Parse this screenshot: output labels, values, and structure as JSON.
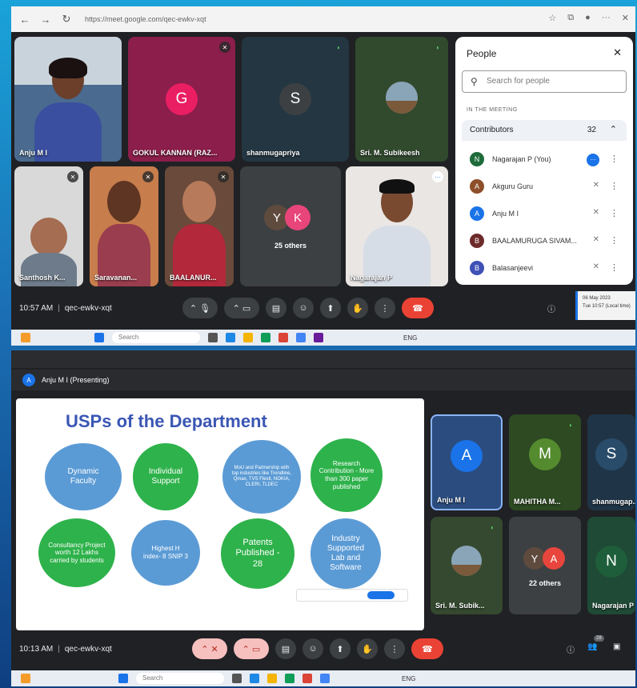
{
  "screen1": {
    "browser": {
      "url": "https://meet.google.com/qec-ewkv-xqt"
    },
    "tiles": [
      {
        "name": "Anju M I"
      },
      {
        "name": "GOKUL KANNAN (RAZ...",
        "initial": "G",
        "color": "#e91e63"
      },
      {
        "name": "shanmugapriya",
        "initial": "S",
        "color": "#3c4043"
      },
      {
        "name": "Sri. M. Subikeesh"
      },
      {
        "name": "Santhosh K..."
      },
      {
        "name": "Saravanan..."
      },
      {
        "name": "BAALANUR..."
      },
      {
        "others_label": "25 others",
        "initials": [
          "Y",
          "K"
        ]
      },
      {
        "name": "Nagarajan P"
      }
    ],
    "people_panel": {
      "title": "People",
      "search_placeholder": "Search for people",
      "section": "IN THE MEETING",
      "contributors_label": "Contributors",
      "contributors_count": "32",
      "people": [
        {
          "initial": "N",
          "name": "Nagarajan P (You)",
          "color": "#1e6b3a"
        },
        {
          "initial": "A",
          "name": "Akguru Guru",
          "color": "#8d4e2a"
        },
        {
          "initial": "A",
          "name": "Anju M I",
          "color": "#1a73e8"
        },
        {
          "initial": "B",
          "name": "BAALAMURUGA SIVAM...",
          "color": "#6d2a2a"
        },
        {
          "initial": "B",
          "name": "Balasanjeevi",
          "color": "#3f51b5"
        }
      ]
    },
    "bottom_bar": {
      "time": "10:57 AM",
      "meeting_code": "qec-ewkv-xqt"
    },
    "tooltip": {
      "line1": "06 May 2023",
      "line2": "Tue 10:57 (Local time)"
    },
    "taskbar": {
      "search": "Search",
      "lang": "ENG"
    }
  },
  "screen2": {
    "presenting_label": "Anju M I (Presenting)",
    "slide": {
      "title": "USPs of the Department",
      "circles": [
        {
          "text": "Dynamic Faculty",
          "color": "blue"
        },
        {
          "text": "Individual Support",
          "color": "green"
        },
        {
          "text": "MoU and Partnership with top industries like Trendline, Qmax, TVS Flexit, NOKIA, CLERI, TLDEC",
          "color": "blue"
        },
        {
          "text": "Research Contribution - More than 300 paper published",
          "color": "green"
        },
        {
          "text": "Consultancy Project worth 12 Lakhs carried by students",
          "color": "green"
        },
        {
          "text": "Highest H index- 8 SNIP 3",
          "color": "blue"
        },
        {
          "text": "Patents Published - 28",
          "color": "green"
        },
        {
          "text": "Industry Supported Lab and Software",
          "color": "blue"
        }
      ]
    },
    "tiles": [
      {
        "name": "Anju M I",
        "initial": "A",
        "color": "#1a73e8"
      },
      {
        "name": "MAHITHA M...",
        "initial": "M",
        "color": "#2e7d32"
      },
      {
        "name": "shanmugap...",
        "initial": "S",
        "color": "#2a4c6b"
      },
      {
        "name": "Sri. M. Subik..."
      },
      {
        "others_label": "22 others",
        "initials": [
          "Y",
          "A"
        ]
      },
      {
        "name": "Nagarajan P",
        "initial": "N",
        "color": "#1e5e3a"
      }
    ],
    "bottom_bar": {
      "time": "10:13 AM",
      "meeting_code": "qec-ewkv-xqt",
      "people_badge": "28"
    },
    "taskbar": {
      "search": "Search",
      "lang": "ENG"
    }
  }
}
